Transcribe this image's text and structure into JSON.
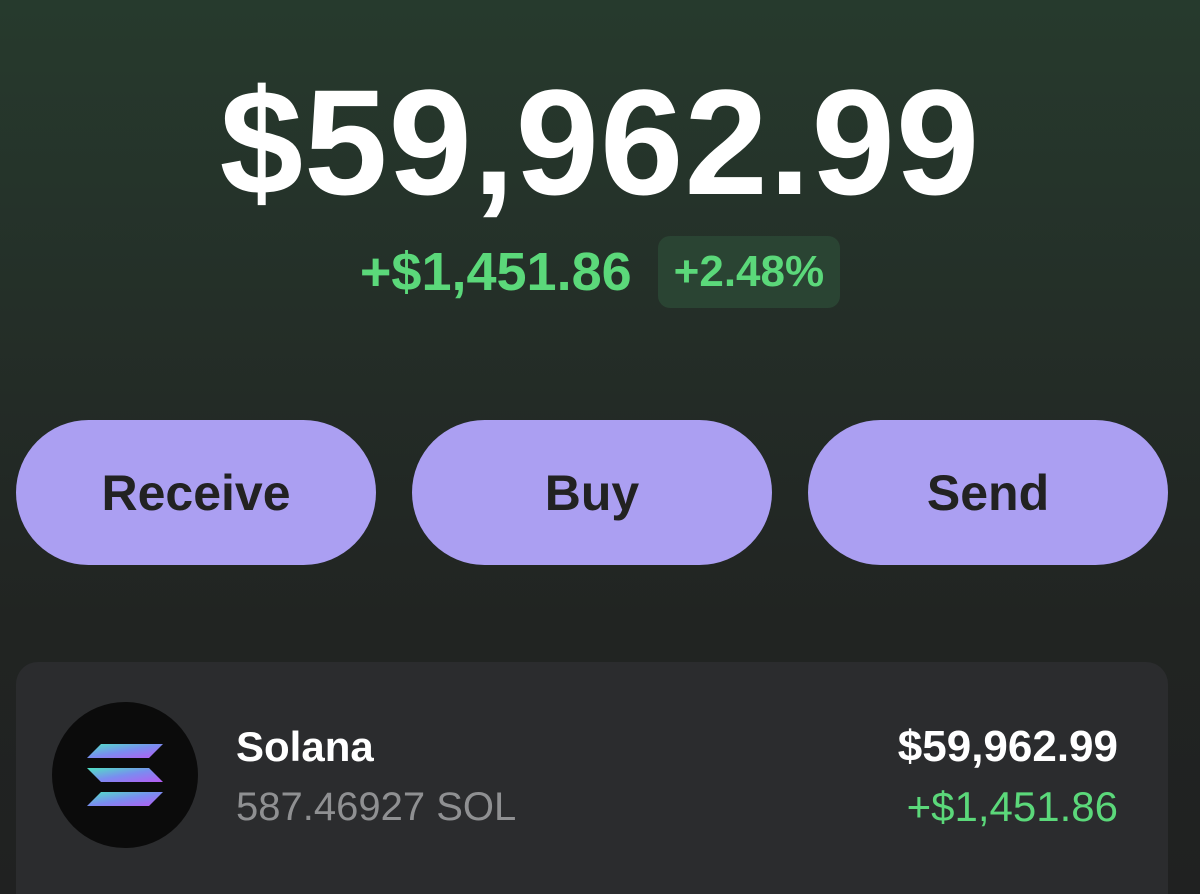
{
  "portfolio": {
    "balance": "$59,962.99",
    "change_amount": "+$1,451.86",
    "change_percent": "+2.48%"
  },
  "actions": {
    "receive_label": "Receive",
    "buy_label": "Buy",
    "send_label": "Send"
  },
  "tokens": [
    {
      "name": "Solana",
      "quantity": "587.46927 SOL",
      "value": "$59,962.99",
      "change": "+$1,451.86",
      "icon": "solana-logo-icon"
    }
  ],
  "colors": {
    "accent": "#ab9ff2",
    "positive": "#5bd87a",
    "card_background": "#2b2c2e"
  }
}
